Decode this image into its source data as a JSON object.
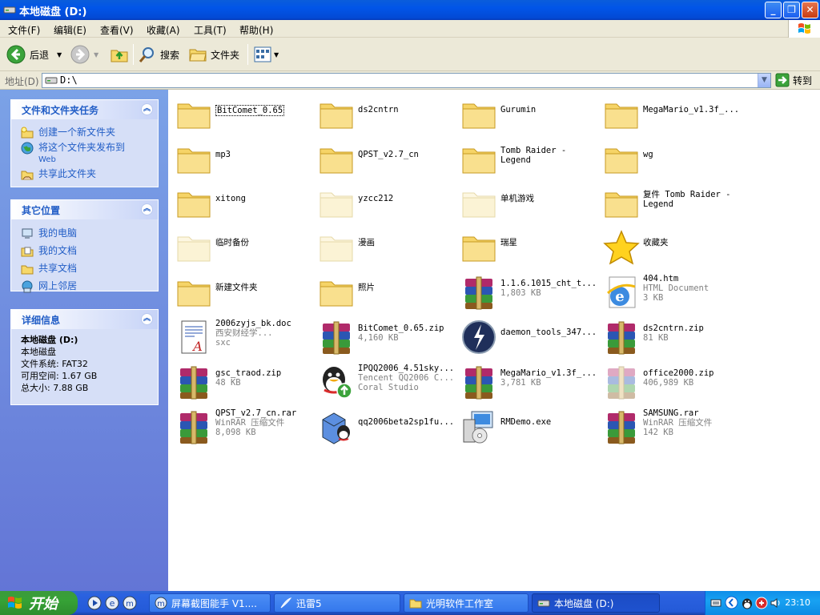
{
  "window": {
    "title": "本地磁盘 (D:)"
  },
  "caption_buttons": {
    "minimize": "_",
    "maximize": "❐",
    "close": "✕"
  },
  "menu": [
    "文件(F)",
    "编辑(E)",
    "查看(V)",
    "收藏(A)",
    "工具(T)",
    "帮助(H)"
  ],
  "toolbar": {
    "back": "后退",
    "search": "搜索",
    "folders": "文件夹"
  },
  "address": {
    "label": "地址(D)",
    "value": "D:\\",
    "go": "转到"
  },
  "sidebar": {
    "tasks": {
      "title": "文件和文件夹任务",
      "items": [
        {
          "label": "创建一个新文件夹",
          "sub": ""
        },
        {
          "label": "将这个文件夹发布到",
          "sub": "Web"
        },
        {
          "label": "共享此文件夹",
          "sub": ""
        }
      ]
    },
    "places": {
      "title": "其它位置",
      "items": [
        "我的电脑",
        "我的文档",
        "共享文档",
        "网上邻居"
      ]
    },
    "details": {
      "title": "详细信息",
      "name": "本地磁盘 (D:)",
      "type": "本地磁盘",
      "fs": "文件系统: FAT32",
      "free": "可用空间: 1.67 GB",
      "total": "总大小: 7.88 GB"
    }
  },
  "files": [
    {
      "name": "BitComet_0.65",
      "type": "folder"
    },
    {
      "name": "ds2cntrn",
      "type": "folder"
    },
    {
      "name": "Gurumin",
      "type": "folder"
    },
    {
      "name": "MegaMario_v1.3f_...",
      "type": "folder"
    },
    {
      "name": "mp3",
      "type": "folder"
    },
    {
      "name": "QPST_v2.7_cn",
      "type": "folder"
    },
    {
      "name": "Tomb Raider -\nLegend",
      "type": "folder"
    },
    {
      "name": "wg",
      "type": "folder"
    },
    {
      "name": "xitong",
      "type": "folder"
    },
    {
      "name": "yzcc212",
      "type": "folder-hidden"
    },
    {
      "name": "单机游戏",
      "type": "folder-hidden"
    },
    {
      "name": "复件 Tomb Raider -\nLegend",
      "type": "folder"
    },
    {
      "name": "临时备份",
      "type": "folder-hidden"
    },
    {
      "name": "漫画",
      "type": "folder-hidden"
    },
    {
      "name": "瑞星",
      "type": "folder"
    },
    {
      "name": "收藏夹",
      "type": "star"
    },
    {
      "name": "新建文件夹",
      "type": "folder"
    },
    {
      "name": "照片",
      "type": "folder"
    },
    {
      "name": "1.1.6.1015_cht_t...",
      "desc": "1,803 KB",
      "type": "winrar"
    },
    {
      "name": "404.htm",
      "desc": "HTML Document\n3 KB",
      "type": "ie"
    },
    {
      "name": "2006zyjs_bk.doc",
      "desc": "西安财经学...\nsxc",
      "type": "doc"
    },
    {
      "name": "BitComet_0.65.zip",
      "desc": "4,160 KB",
      "type": "winrar"
    },
    {
      "name": "daemon_tools_347...",
      "type": "daemon"
    },
    {
      "name": "ds2cntrn.zip",
      "desc": "81 KB",
      "type": "winrar"
    },
    {
      "name": "gsc_traod.zip",
      "desc": "48 KB",
      "type": "winrar"
    },
    {
      "name": "IPQQ2006_4.51sky...",
      "desc": "Tencent QQ2006 C...\nCoral Studio",
      "type": "qq"
    },
    {
      "name": "MegaMario_v1.3f_...",
      "desc": "3,781 KB",
      "type": "winrar"
    },
    {
      "name": "office2000.zip",
      "desc": "406,989 KB",
      "type": "winrar-faded"
    },
    {
      "name": "QPST_v2.7_cn.rar",
      "desc": "WinRAR 压缩文件\n8,098 KB",
      "type": "winrar"
    },
    {
      "name": "qq2006beta2sp1fu...",
      "type": "qqinstall"
    },
    {
      "name": "RMDemo.exe",
      "type": "exe"
    },
    {
      "name": "SAMSUNG.rar",
      "desc": "WinRAR 压缩文件\n142 KB",
      "type": "winrar"
    }
  ],
  "taskbar": {
    "start": "开始",
    "buttons": [
      "屏幕截图能手 V1....",
      "迅雷5",
      "光明软件工作室",
      "本地磁盘 (D:)"
    ],
    "clock": "23:10"
  },
  "colors": {
    "titlebar": "#0155e8",
    "sidebar": "#7ba2e7",
    "panel_link": "#215dc6",
    "start": "#36a236",
    "tray": "#18a2f2"
  }
}
